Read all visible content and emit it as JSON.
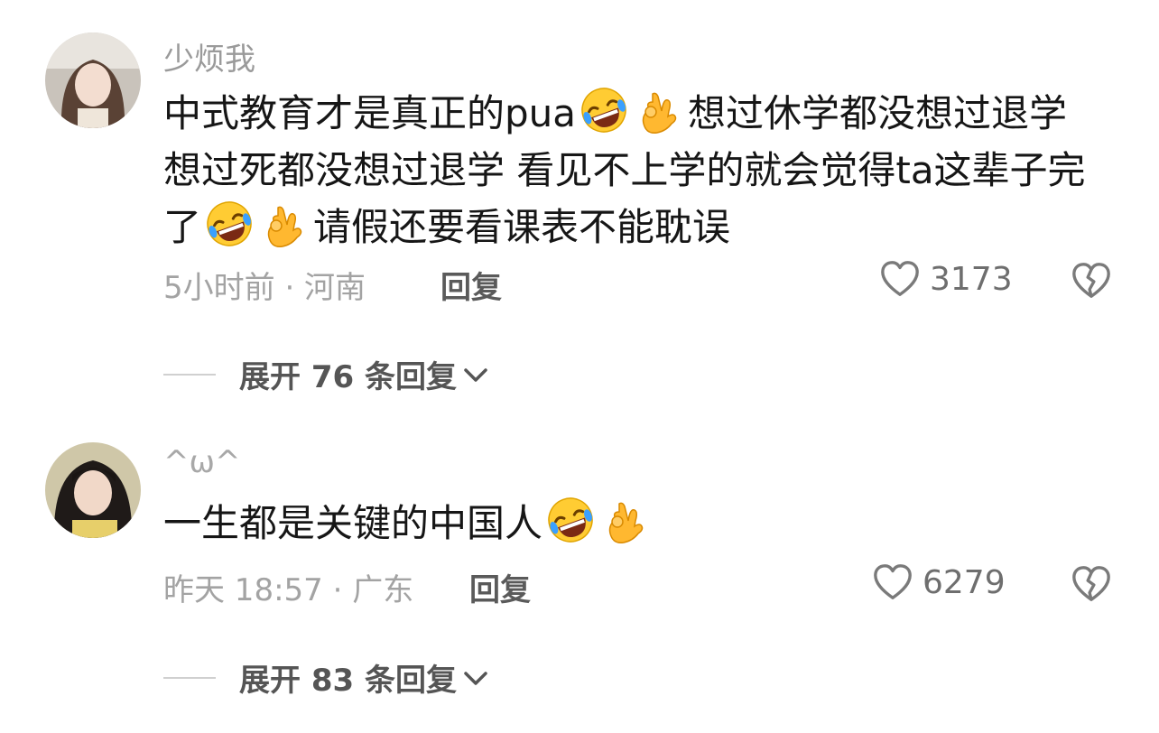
{
  "comments": [
    {
      "username": "少烦我",
      "segments": [
        "中式教育才是真正的pua",
        "想过休学都没想过退学 想过死都没想过退学 看见不上学的就会觉得ta这辈子完了",
        "请假还要看课表不能耽误"
      ],
      "emojis": [
        "rofl-face-icon",
        "ok-hand-icon"
      ],
      "time": "5小时前 · 河南",
      "reply_label": "回复",
      "likes": "3173",
      "expand_label": "展开 76 条回复"
    },
    {
      "username": "^ω^",
      "segments": [
        "一生都是关键的中国人"
      ],
      "emojis": [
        "rofl-face-icon",
        "ok-hand-icon"
      ],
      "time": "昨天 18:57 · 广东",
      "reply_label": "回复",
      "likes": "6279",
      "expand_label": "展开 83 条回复"
    }
  ]
}
